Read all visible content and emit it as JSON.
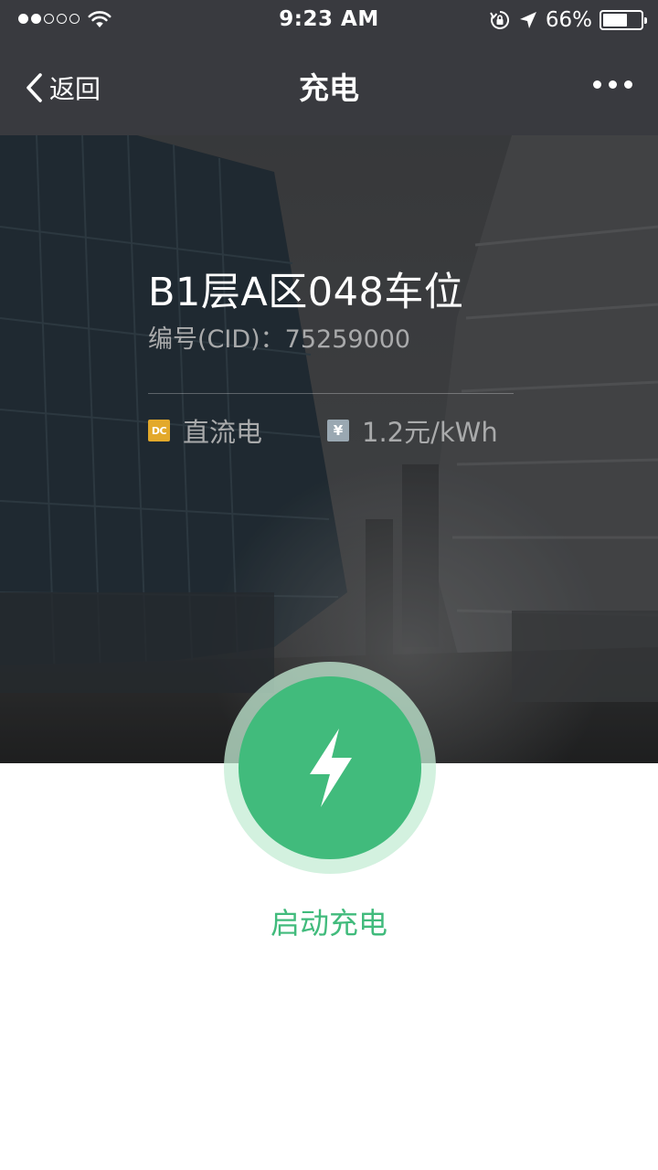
{
  "status_bar": {
    "time": "9:23 AM",
    "battery_percent_label": "66%",
    "battery_level": 0.66,
    "signal_bars_filled": 2,
    "signal_bars_total": 5,
    "icons": [
      "signal-dots-icon",
      "wifi-icon",
      "rotation-lock-icon",
      "location-arrow-icon",
      "battery-icon"
    ]
  },
  "nav": {
    "back_label": "返回",
    "title": "充电",
    "icons": [
      "chevron-left-icon",
      "more-dots-icon"
    ]
  },
  "hero": {
    "spot_name": "B1层A区048车位",
    "cid_text": "编号(CID)：75259000",
    "current_type_badge": "DC",
    "current_type": "直流电",
    "price_badge": "¥",
    "price": "1.2元/kWh"
  },
  "action": {
    "start_label": "启动充电",
    "icon": "lightning-bolt-icon"
  },
  "colors": {
    "bar_bg": "#393a3f",
    "accent_green": "#41bb7c",
    "ring_green": "#c4ecd4",
    "dc_badge": "#e3a92b",
    "price_badge": "#9aa8b2",
    "muted_text": "#a9aaab"
  }
}
